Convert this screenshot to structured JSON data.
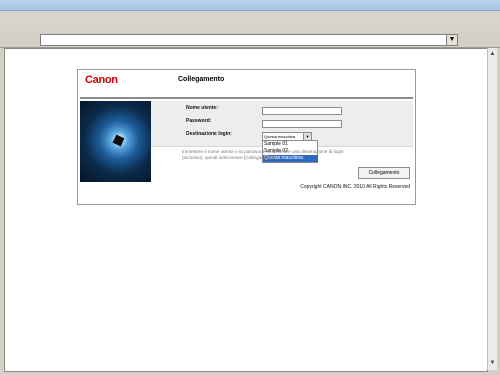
{
  "browser": {
    "address_value": "",
    "dropdown_icon": "▼",
    "scroll_up_icon": "▲",
    "scroll_down_icon": "▼"
  },
  "login": {
    "logo": "Canon",
    "title": "Collegamento",
    "username_label": "Nome utente:",
    "username_value": "",
    "password_label": "Password:",
    "password_value": "",
    "destination_label": "Destinazione login:",
    "destination_selected": "Questa macchina",
    "destination_options": [
      "Sample 01",
      "Sample 02",
      "Questa macchina"
    ],
    "info_text_left": "Immettere il nome utente e la password, selezionare una destinazione di login",
    "info_text_left_2": "(accesso), quindi selezionare [Collegamento].",
    "login_button": "Collegamento",
    "copyright": "Copyright CANON INC. 2010 All Rights Reserved"
  }
}
